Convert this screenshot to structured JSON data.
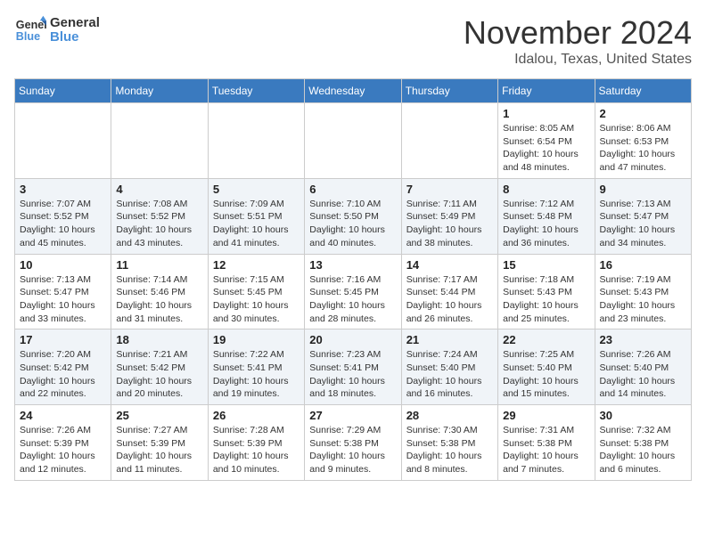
{
  "logo": {
    "line1": "General",
    "line2": "Blue"
  },
  "title": "November 2024",
  "location": "Idalou, Texas, United States",
  "weekdays": [
    "Sunday",
    "Monday",
    "Tuesday",
    "Wednesday",
    "Thursday",
    "Friday",
    "Saturday"
  ],
  "weeks": [
    [
      {
        "day": null,
        "info": null
      },
      {
        "day": null,
        "info": null
      },
      {
        "day": null,
        "info": null
      },
      {
        "day": null,
        "info": null
      },
      {
        "day": null,
        "info": null
      },
      {
        "day": "1",
        "info": "Sunrise: 8:05 AM\nSunset: 6:54 PM\nDaylight: 10 hours\nand 48 minutes."
      },
      {
        "day": "2",
        "info": "Sunrise: 8:06 AM\nSunset: 6:53 PM\nDaylight: 10 hours\nand 47 minutes."
      }
    ],
    [
      {
        "day": "3",
        "info": "Sunrise: 7:07 AM\nSunset: 5:52 PM\nDaylight: 10 hours\nand 45 minutes."
      },
      {
        "day": "4",
        "info": "Sunrise: 7:08 AM\nSunset: 5:52 PM\nDaylight: 10 hours\nand 43 minutes."
      },
      {
        "day": "5",
        "info": "Sunrise: 7:09 AM\nSunset: 5:51 PM\nDaylight: 10 hours\nand 41 minutes."
      },
      {
        "day": "6",
        "info": "Sunrise: 7:10 AM\nSunset: 5:50 PM\nDaylight: 10 hours\nand 40 minutes."
      },
      {
        "day": "7",
        "info": "Sunrise: 7:11 AM\nSunset: 5:49 PM\nDaylight: 10 hours\nand 38 minutes."
      },
      {
        "day": "8",
        "info": "Sunrise: 7:12 AM\nSunset: 5:48 PM\nDaylight: 10 hours\nand 36 minutes."
      },
      {
        "day": "9",
        "info": "Sunrise: 7:13 AM\nSunset: 5:47 PM\nDaylight: 10 hours\nand 34 minutes."
      }
    ],
    [
      {
        "day": "10",
        "info": "Sunrise: 7:13 AM\nSunset: 5:47 PM\nDaylight: 10 hours\nand 33 minutes."
      },
      {
        "day": "11",
        "info": "Sunrise: 7:14 AM\nSunset: 5:46 PM\nDaylight: 10 hours\nand 31 minutes."
      },
      {
        "day": "12",
        "info": "Sunrise: 7:15 AM\nSunset: 5:45 PM\nDaylight: 10 hours\nand 30 minutes."
      },
      {
        "day": "13",
        "info": "Sunrise: 7:16 AM\nSunset: 5:45 PM\nDaylight: 10 hours\nand 28 minutes."
      },
      {
        "day": "14",
        "info": "Sunrise: 7:17 AM\nSunset: 5:44 PM\nDaylight: 10 hours\nand 26 minutes."
      },
      {
        "day": "15",
        "info": "Sunrise: 7:18 AM\nSunset: 5:43 PM\nDaylight: 10 hours\nand 25 minutes."
      },
      {
        "day": "16",
        "info": "Sunrise: 7:19 AM\nSunset: 5:43 PM\nDaylight: 10 hours\nand 23 minutes."
      }
    ],
    [
      {
        "day": "17",
        "info": "Sunrise: 7:20 AM\nSunset: 5:42 PM\nDaylight: 10 hours\nand 22 minutes."
      },
      {
        "day": "18",
        "info": "Sunrise: 7:21 AM\nSunset: 5:42 PM\nDaylight: 10 hours\nand 20 minutes."
      },
      {
        "day": "19",
        "info": "Sunrise: 7:22 AM\nSunset: 5:41 PM\nDaylight: 10 hours\nand 19 minutes."
      },
      {
        "day": "20",
        "info": "Sunrise: 7:23 AM\nSunset: 5:41 PM\nDaylight: 10 hours\nand 18 minutes."
      },
      {
        "day": "21",
        "info": "Sunrise: 7:24 AM\nSunset: 5:40 PM\nDaylight: 10 hours\nand 16 minutes."
      },
      {
        "day": "22",
        "info": "Sunrise: 7:25 AM\nSunset: 5:40 PM\nDaylight: 10 hours\nand 15 minutes."
      },
      {
        "day": "23",
        "info": "Sunrise: 7:26 AM\nSunset: 5:40 PM\nDaylight: 10 hours\nand 14 minutes."
      }
    ],
    [
      {
        "day": "24",
        "info": "Sunrise: 7:26 AM\nSunset: 5:39 PM\nDaylight: 10 hours\nand 12 minutes."
      },
      {
        "day": "25",
        "info": "Sunrise: 7:27 AM\nSunset: 5:39 PM\nDaylight: 10 hours\nand 11 minutes."
      },
      {
        "day": "26",
        "info": "Sunrise: 7:28 AM\nSunset: 5:39 PM\nDaylight: 10 hours\nand 10 minutes."
      },
      {
        "day": "27",
        "info": "Sunrise: 7:29 AM\nSunset: 5:38 PM\nDaylight: 10 hours\nand 9 minutes."
      },
      {
        "day": "28",
        "info": "Sunrise: 7:30 AM\nSunset: 5:38 PM\nDaylight: 10 hours\nand 8 minutes."
      },
      {
        "day": "29",
        "info": "Sunrise: 7:31 AM\nSunset: 5:38 PM\nDaylight: 10 hours\nand 7 minutes."
      },
      {
        "day": "30",
        "info": "Sunrise: 7:32 AM\nSunset: 5:38 PM\nDaylight: 10 hours\nand 6 minutes."
      }
    ]
  ]
}
